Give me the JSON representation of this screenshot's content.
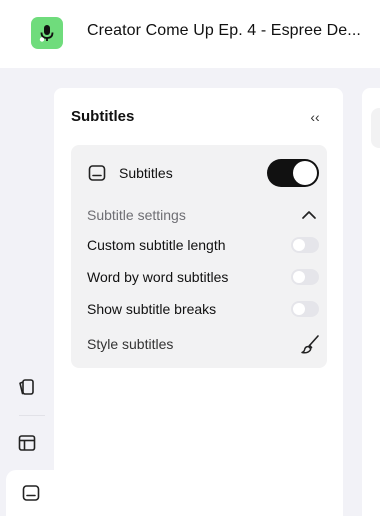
{
  "header": {
    "app_icon": "microphone-icon",
    "title": "Creator Come Up Ep. 4 - Espree De..."
  },
  "rail": {
    "items": [
      {
        "icon": "cards-icon"
      },
      {
        "icon": "layout-icon"
      },
      {
        "icon": "subtitles-icon",
        "active": true
      }
    ]
  },
  "panel": {
    "title": "Subtitles",
    "collapse_icon": "double-chevron-left-icon",
    "collapse_glyph": "‹‹",
    "subtitles_toggle": {
      "label": "Subtitles",
      "on": true
    },
    "settings_header": "Subtitle settings",
    "options": [
      {
        "label": "Custom subtitle length",
        "on": false
      },
      {
        "label": "Word by word subtitles",
        "on": false
      },
      {
        "label": "Show subtitle breaks",
        "on": false
      }
    ],
    "style_label": "Style subtitles",
    "style_icon": "brush-icon"
  },
  "colors": {
    "brand_green": "#6fdc7c",
    "toggle_on": "#111111",
    "toggle_off": "#e5e5ea",
    "background": "#f2f2f7"
  }
}
